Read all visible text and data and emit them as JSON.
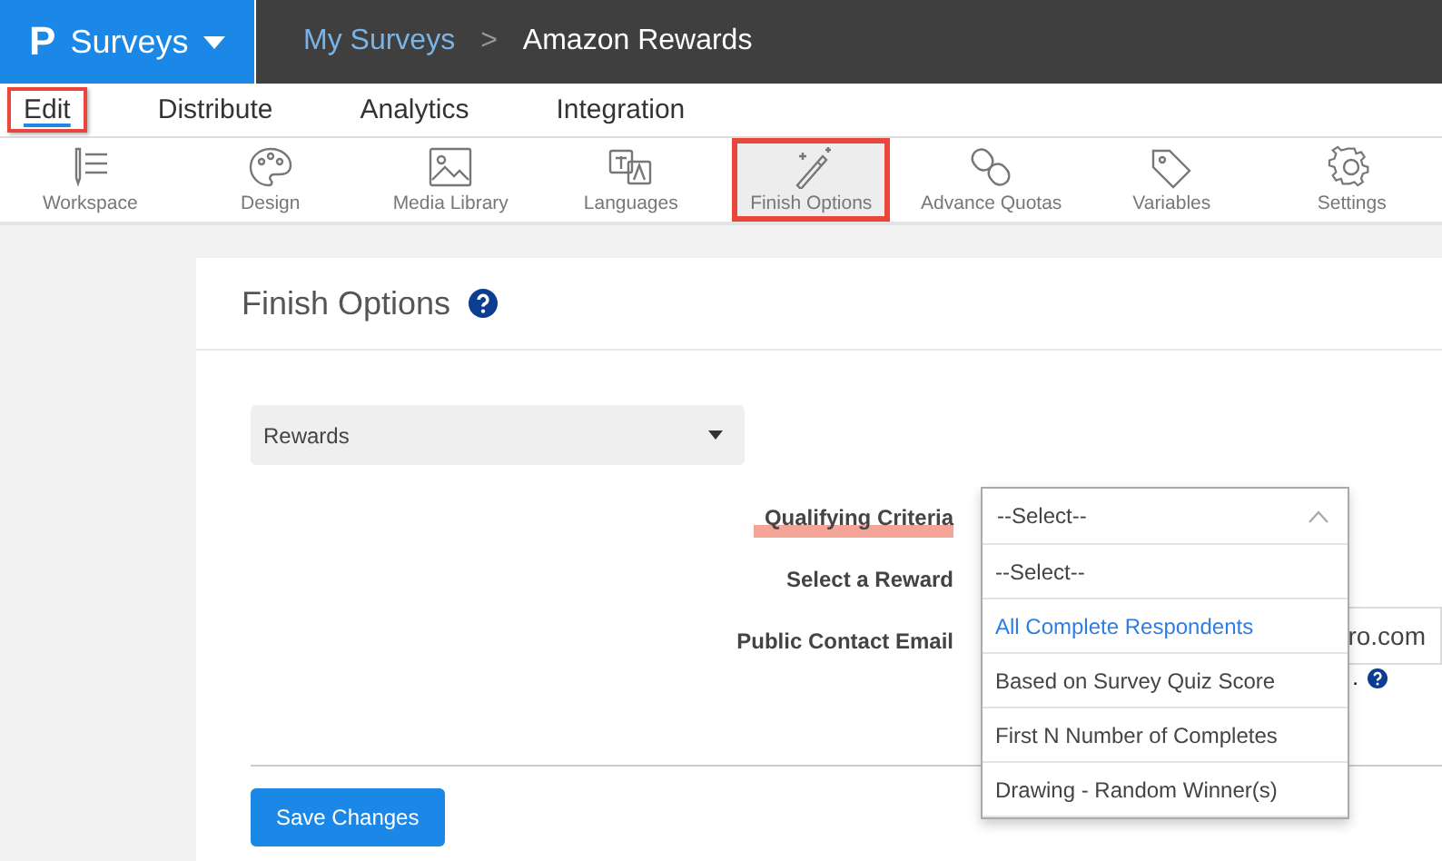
{
  "brand": {
    "logo": "P",
    "title": "Surveys"
  },
  "breadcrumb": [
    {
      "label": "My Surveys",
      "separator": ">"
    },
    {
      "label": "Amazon Rewards"
    }
  ],
  "tabs": [
    {
      "label": "Edit",
      "selected": true,
      "highlighted": true
    },
    {
      "label": "Distribute",
      "selected": false,
      "highlighted": false
    },
    {
      "label": "Analytics",
      "selected": false,
      "highlighted": false
    },
    {
      "label": "Integration",
      "selected": false,
      "highlighted": false
    }
  ],
  "toolbar": [
    {
      "label": "Workspace",
      "selected": false
    },
    {
      "label": "Design",
      "selected": false
    },
    {
      "label": "Media Library",
      "selected": false
    },
    {
      "label": "Languages",
      "selected": false
    },
    {
      "label": "Finish Options",
      "selected": true
    },
    {
      "label": "Advance Quotas",
      "selected": false
    },
    {
      "label": "Variables",
      "selected": false
    },
    {
      "label": "Settings",
      "selected": false
    }
  ],
  "panel": {
    "title": "Finish Options",
    "category_select": {
      "value": "Rewards"
    },
    "fields": [
      {
        "label": "Qualifying Criteria",
        "underlined": true
      },
      {
        "label": "Select a Reward",
        "underlined": false
      },
      {
        "label": "Public Contact Email",
        "underlined": false,
        "value": "ro.com",
        "hint": "."
      }
    ],
    "dropdown": {
      "value": "--Select--",
      "options": [
        {
          "label": "--Select--",
          "highlighted": false
        },
        {
          "label": "All Complete Respondents",
          "highlighted": true
        },
        {
          "label": "Based on Survey Quiz Score",
          "highlighted": false
        },
        {
          "label": "First N Number of Completes",
          "highlighted": false
        },
        {
          "label": "Drawing - Random Winner(s)",
          "highlighted": false
        }
      ]
    },
    "save_button": "Save Changes"
  }
}
